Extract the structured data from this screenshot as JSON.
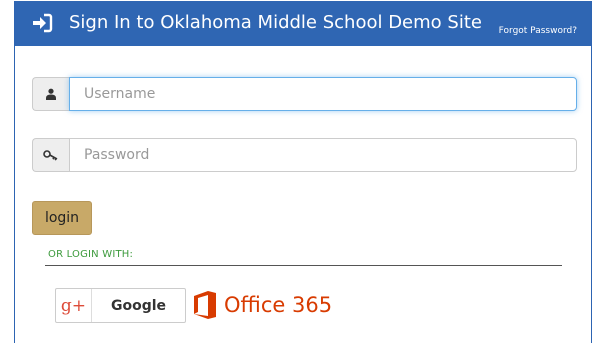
{
  "header": {
    "title": "Sign In to Oklahoma Middle School Demo Site",
    "forgot_password": "Forgot Password?"
  },
  "form": {
    "username": {
      "placeholder": "Username",
      "value": ""
    },
    "password": {
      "placeholder": "Password",
      "value": ""
    },
    "login_label": "login"
  },
  "alt_login": {
    "heading": "OR LOGIN WITH:",
    "google_icon_text": "g+",
    "google_label": "Google",
    "office_label": "Office 365"
  },
  "colors": {
    "header_bg": "#2f66b3",
    "login_button": "#c8a968",
    "or_login_text": "#3c9a3c",
    "google_red": "#dd4b39",
    "office_orange": "#d83b01"
  },
  "icons": {
    "header": "sign-in-icon",
    "username": "user-icon",
    "password": "key-icon",
    "google": "google-plus-icon",
    "office": "office-logo-icon"
  }
}
